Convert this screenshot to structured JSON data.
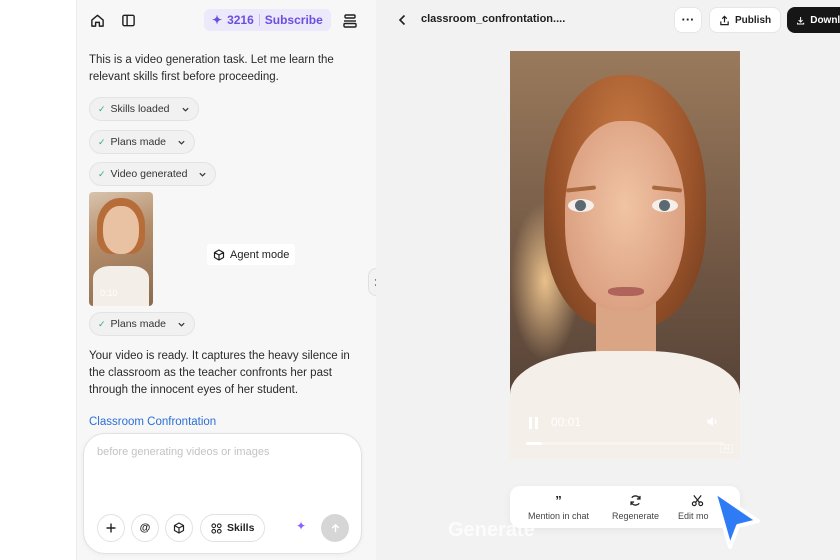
{
  "top_bar": {
    "credits": "3216",
    "subscribe_label": "Subscribe"
  },
  "chat": {
    "intro_message": "This is a video generation task. Let me learn the relevant skills first before proceeding.",
    "chips": [
      {
        "label": "Skills loaded"
      },
      {
        "label": "Plans made"
      },
      {
        "label": "Video generated"
      },
      {
        "label": "Plans made"
      }
    ],
    "video_thumb": {
      "duration": "0:10"
    },
    "agent_mode_tooltip": "Agent mode",
    "result_message": "Your video is ready. It captures the heavy silence in the classroom as the teacher confronts her past through the innocent eyes of her student.",
    "link_label": "Classroom Confrontation",
    "composer": {
      "placeholder": "before generating videos or images",
      "skills_label": "Skills"
    }
  },
  "preview": {
    "file_title": "classroom_confrontation....",
    "publish_label": "Publish",
    "download_label": "Download",
    "player": {
      "current_time": "00:01",
      "progress": 0.08,
      "watermark": "AI"
    },
    "actions": [
      {
        "label": "Mention in chat",
        "icon": "quote-icon"
      },
      {
        "label": "Regenerate",
        "icon": "refresh-icon"
      },
      {
        "label": "Edit mo",
        "icon": "scissors-icon"
      }
    ],
    "ghost_label": "Generate"
  },
  "colors": {
    "accent": "#6b4fe0",
    "link": "#2b6fd6",
    "dark_button": "#161616",
    "sparkle": "#8a63ff",
    "cursor": "#2f7bf6"
  }
}
